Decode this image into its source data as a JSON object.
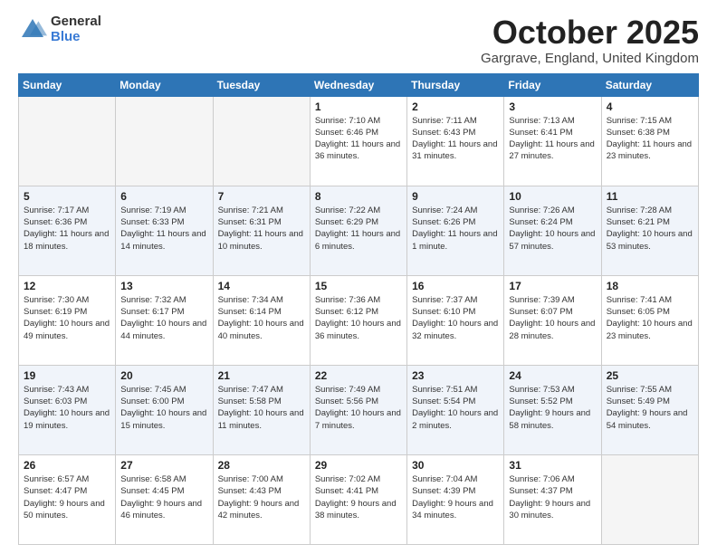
{
  "header": {
    "logo_general": "General",
    "logo_blue": "Blue",
    "month_title": "October 2025",
    "location": "Gargrave, England, United Kingdom"
  },
  "days_of_week": [
    "Sunday",
    "Monday",
    "Tuesday",
    "Wednesday",
    "Thursday",
    "Friday",
    "Saturday"
  ],
  "weeks": [
    [
      {
        "day": "",
        "sunrise": "",
        "sunset": "",
        "daylight": ""
      },
      {
        "day": "",
        "sunrise": "",
        "sunset": "",
        "daylight": ""
      },
      {
        "day": "",
        "sunrise": "",
        "sunset": "",
        "daylight": ""
      },
      {
        "day": "1",
        "sunrise": "Sunrise: 7:10 AM",
        "sunset": "Sunset: 6:46 PM",
        "daylight": "Daylight: 11 hours and 36 minutes."
      },
      {
        "day": "2",
        "sunrise": "Sunrise: 7:11 AM",
        "sunset": "Sunset: 6:43 PM",
        "daylight": "Daylight: 11 hours and 31 minutes."
      },
      {
        "day": "3",
        "sunrise": "Sunrise: 7:13 AM",
        "sunset": "Sunset: 6:41 PM",
        "daylight": "Daylight: 11 hours and 27 minutes."
      },
      {
        "day": "4",
        "sunrise": "Sunrise: 7:15 AM",
        "sunset": "Sunset: 6:38 PM",
        "daylight": "Daylight: 11 hours and 23 minutes."
      }
    ],
    [
      {
        "day": "5",
        "sunrise": "Sunrise: 7:17 AM",
        "sunset": "Sunset: 6:36 PM",
        "daylight": "Daylight: 11 hours and 18 minutes."
      },
      {
        "day": "6",
        "sunrise": "Sunrise: 7:19 AM",
        "sunset": "Sunset: 6:33 PM",
        "daylight": "Daylight: 11 hours and 14 minutes."
      },
      {
        "day": "7",
        "sunrise": "Sunrise: 7:21 AM",
        "sunset": "Sunset: 6:31 PM",
        "daylight": "Daylight: 11 hours and 10 minutes."
      },
      {
        "day": "8",
        "sunrise": "Sunrise: 7:22 AM",
        "sunset": "Sunset: 6:29 PM",
        "daylight": "Daylight: 11 hours and 6 minutes."
      },
      {
        "day": "9",
        "sunrise": "Sunrise: 7:24 AM",
        "sunset": "Sunset: 6:26 PM",
        "daylight": "Daylight: 11 hours and 1 minute."
      },
      {
        "day": "10",
        "sunrise": "Sunrise: 7:26 AM",
        "sunset": "Sunset: 6:24 PM",
        "daylight": "Daylight: 10 hours and 57 minutes."
      },
      {
        "day": "11",
        "sunrise": "Sunrise: 7:28 AM",
        "sunset": "Sunset: 6:21 PM",
        "daylight": "Daylight: 10 hours and 53 minutes."
      }
    ],
    [
      {
        "day": "12",
        "sunrise": "Sunrise: 7:30 AM",
        "sunset": "Sunset: 6:19 PM",
        "daylight": "Daylight: 10 hours and 49 minutes."
      },
      {
        "day": "13",
        "sunrise": "Sunrise: 7:32 AM",
        "sunset": "Sunset: 6:17 PM",
        "daylight": "Daylight: 10 hours and 44 minutes."
      },
      {
        "day": "14",
        "sunrise": "Sunrise: 7:34 AM",
        "sunset": "Sunset: 6:14 PM",
        "daylight": "Daylight: 10 hours and 40 minutes."
      },
      {
        "day": "15",
        "sunrise": "Sunrise: 7:36 AM",
        "sunset": "Sunset: 6:12 PM",
        "daylight": "Daylight: 10 hours and 36 minutes."
      },
      {
        "day": "16",
        "sunrise": "Sunrise: 7:37 AM",
        "sunset": "Sunset: 6:10 PM",
        "daylight": "Daylight: 10 hours and 32 minutes."
      },
      {
        "day": "17",
        "sunrise": "Sunrise: 7:39 AM",
        "sunset": "Sunset: 6:07 PM",
        "daylight": "Daylight: 10 hours and 28 minutes."
      },
      {
        "day": "18",
        "sunrise": "Sunrise: 7:41 AM",
        "sunset": "Sunset: 6:05 PM",
        "daylight": "Daylight: 10 hours and 23 minutes."
      }
    ],
    [
      {
        "day": "19",
        "sunrise": "Sunrise: 7:43 AM",
        "sunset": "Sunset: 6:03 PM",
        "daylight": "Daylight: 10 hours and 19 minutes."
      },
      {
        "day": "20",
        "sunrise": "Sunrise: 7:45 AM",
        "sunset": "Sunset: 6:00 PM",
        "daylight": "Daylight: 10 hours and 15 minutes."
      },
      {
        "day": "21",
        "sunrise": "Sunrise: 7:47 AM",
        "sunset": "Sunset: 5:58 PM",
        "daylight": "Daylight: 10 hours and 11 minutes."
      },
      {
        "day": "22",
        "sunrise": "Sunrise: 7:49 AM",
        "sunset": "Sunset: 5:56 PM",
        "daylight": "Daylight: 10 hours and 7 minutes."
      },
      {
        "day": "23",
        "sunrise": "Sunrise: 7:51 AM",
        "sunset": "Sunset: 5:54 PM",
        "daylight": "Daylight: 10 hours and 2 minutes."
      },
      {
        "day": "24",
        "sunrise": "Sunrise: 7:53 AM",
        "sunset": "Sunset: 5:52 PM",
        "daylight": "Daylight: 9 hours and 58 minutes."
      },
      {
        "day": "25",
        "sunrise": "Sunrise: 7:55 AM",
        "sunset": "Sunset: 5:49 PM",
        "daylight": "Daylight: 9 hours and 54 minutes."
      }
    ],
    [
      {
        "day": "26",
        "sunrise": "Sunrise: 6:57 AM",
        "sunset": "Sunset: 4:47 PM",
        "daylight": "Daylight: 9 hours and 50 minutes."
      },
      {
        "day": "27",
        "sunrise": "Sunrise: 6:58 AM",
        "sunset": "Sunset: 4:45 PM",
        "daylight": "Daylight: 9 hours and 46 minutes."
      },
      {
        "day": "28",
        "sunrise": "Sunrise: 7:00 AM",
        "sunset": "Sunset: 4:43 PM",
        "daylight": "Daylight: 9 hours and 42 minutes."
      },
      {
        "day": "29",
        "sunrise": "Sunrise: 7:02 AM",
        "sunset": "Sunset: 4:41 PM",
        "daylight": "Daylight: 9 hours and 38 minutes."
      },
      {
        "day": "30",
        "sunrise": "Sunrise: 7:04 AM",
        "sunset": "Sunset: 4:39 PM",
        "daylight": "Daylight: 9 hours and 34 minutes."
      },
      {
        "day": "31",
        "sunrise": "Sunrise: 7:06 AM",
        "sunset": "Sunset: 4:37 PM",
        "daylight": "Daylight: 9 hours and 30 minutes."
      },
      {
        "day": "",
        "sunrise": "",
        "sunset": "",
        "daylight": ""
      }
    ]
  ]
}
